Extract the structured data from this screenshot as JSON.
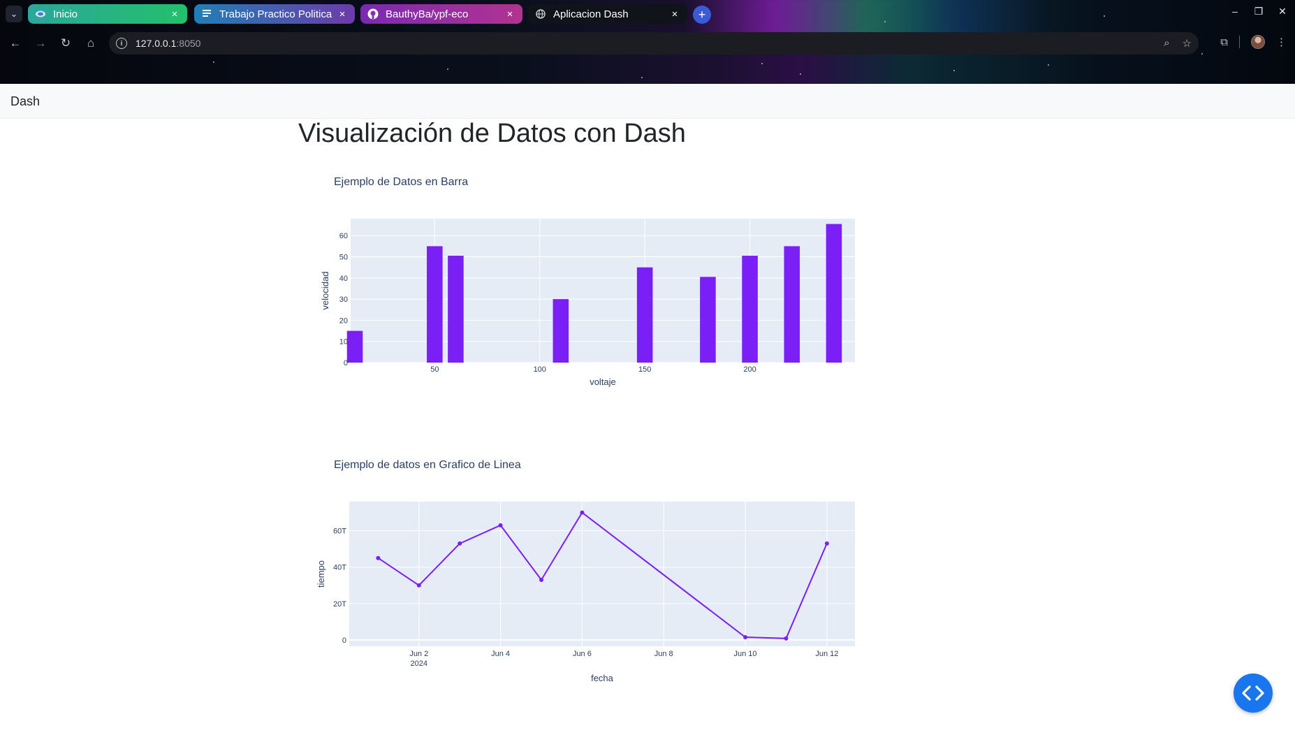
{
  "browser": {
    "tabs": [
      {
        "title": "Inicio",
        "icon": "swirl-favicon-icon"
      },
      {
        "title": "Trabajo Practico Politica",
        "icon": "docs-favicon-icon"
      },
      {
        "title": "BauthyBa/ypf-eco",
        "icon": "github-favicon-icon"
      },
      {
        "title": "Aplicacion Dash",
        "icon": "globe-favicon-icon"
      }
    ],
    "active_tab": 3,
    "address": {
      "host": "127.0.0.1",
      "port": ":8050"
    },
    "glyphs": {
      "close": "×",
      "new_tab": "+",
      "back": "←",
      "forward": "→",
      "reload": "↻",
      "home": "⌂",
      "zoom": "⌕",
      "star": "☆",
      "extensions": "⧉",
      "menu": "⋮",
      "chevron": "⌄",
      "minimize": "–",
      "restore": "❐",
      "win_close": "✕",
      "info": "i"
    }
  },
  "page": {
    "brand": "Dash",
    "title": "Visualización de Datos con Dash",
    "fab_label": "‹›"
  },
  "chart_data": [
    {
      "type": "bar",
      "title": "Ejemplo de Datos en Barra",
      "xlabel": "voltaje",
      "ylabel": "velocidad",
      "x": [
        12,
        50,
        60,
        110,
        150,
        180,
        200,
        220,
        240
      ],
      "values": [
        15,
        55,
        50.5,
        30,
        45,
        40.5,
        50.5,
        55,
        65.5
      ],
      "xlim": [
        10,
        250
      ],
      "ylim": [
        0,
        68
      ],
      "xticks": [
        50,
        100,
        150,
        200
      ],
      "yticks": [
        0,
        10,
        20,
        30,
        40,
        50,
        60
      ],
      "bar_width": 7.5,
      "color": "#7b1ff7",
      "plot_bg": "#e5ecf6",
      "grid": true
    },
    {
      "type": "line",
      "title": "Ejemplo de datos en Grafico de Linea",
      "xlabel": "fecha",
      "ylabel": "tiempo",
      "x": [
        "2024-06-01",
        "2024-06-02",
        "2024-06-03",
        "2024-06-04",
        "2024-06-05",
        "2024-06-06",
        "2024-06-10",
        "2024-06-11",
        "2024-06-12"
      ],
      "values": [
        45000000000000,
        30000000000000,
        53000000000000,
        63000000000000,
        33000000000000,
        70000000000000,
        1500000000000,
        800000000000,
        53000000000000
      ],
      "xlim": [
        "2024-05-31T07:00",
        "2024-06-12T16:30"
      ],
      "ylim": [
        -3500000000000,
        76000000000000
      ],
      "xticks": [
        "2024-06-02",
        "2024-06-04",
        "2024-06-06",
        "2024-06-08",
        "2024-06-10",
        "2024-06-12"
      ],
      "xtick_labels": [
        "Jun 2",
        "Jun 4",
        "Jun 6",
        "Jun 8",
        "Jun 10",
        "Jun 12"
      ],
      "xtick_sublabel": "2024",
      "yticks": [
        0,
        20000000000000,
        40000000000000,
        60000000000000
      ],
      "ytick_labels": [
        "0",
        "20T",
        "40T",
        "60T"
      ],
      "color": "#7b1ff7",
      "plot_bg": "#e5ecf6",
      "grid": true
    }
  ]
}
